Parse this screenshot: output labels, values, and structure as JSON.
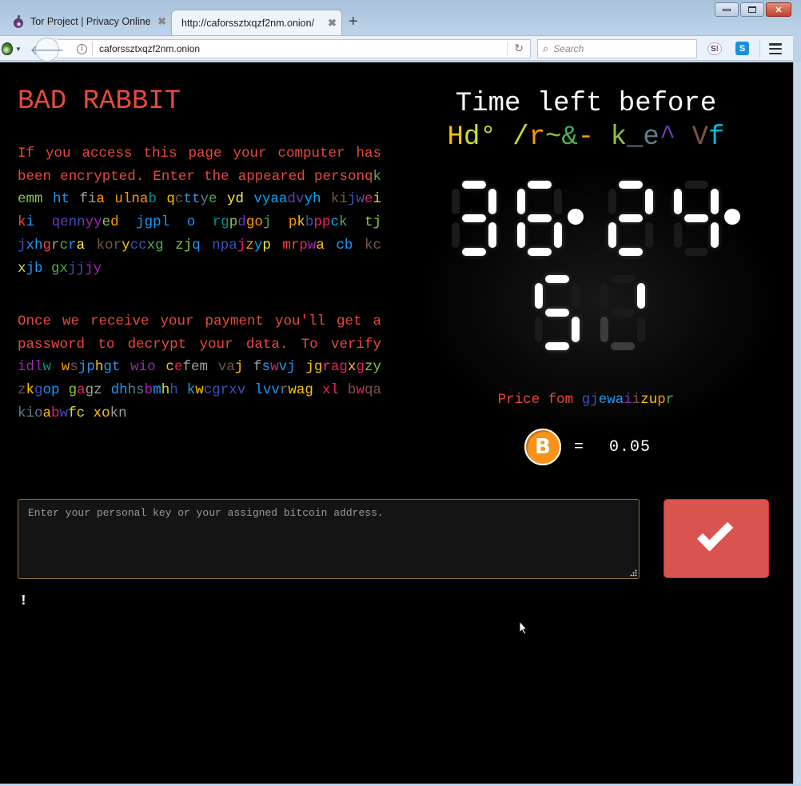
{
  "browser": {
    "tabs": [
      {
        "label": "Tor Project | Privacy Online",
        "icon": "tor-onion-icon",
        "active": false
      },
      {
        "label": "http://caforssztxqzf2nm.onion/",
        "active": true
      }
    ],
    "new_tab_label": "+",
    "close_tab_glyph": "✖",
    "url": "caforssztxqzf2nm.onion",
    "search_placeholder": "Search",
    "window_controls": {
      "minimize": "▭",
      "maximize": "▫",
      "close": "✕"
    },
    "extensions": [
      {
        "name": "S!",
        "color": "#1c3a8c"
      },
      {
        "name": "S",
        "color": "#1a8fdc"
      }
    ]
  },
  "page": {
    "title": "BAD RABBIT",
    "paragraph1": [
      [
        "If you access this page your computer has been encrypted. Enter the appeared person",
        "#e74a3b"
      ],
      [
        "q",
        "#e74a3b"
      ],
      [
        "k ",
        "#4caf50"
      ],
      [
        "emm ",
        "#8bc34a"
      ],
      [
        "ht ",
        "#2196f3"
      ],
      [
        "fi",
        "#9e9e9e"
      ],
      [
        "a ",
        "#ff9800"
      ],
      [
        "ulna",
        "#ff9800"
      ],
      [
        "b ",
        "#009688"
      ],
      [
        "q",
        "#ffc107"
      ],
      [
        "c",
        "#795548"
      ],
      [
        "tt",
        "#2196f3"
      ],
      [
        "y",
        "#607d8b"
      ],
      [
        "e ",
        "#4caf50"
      ],
      [
        "yd ",
        "#ffeb3b"
      ],
      [
        "vyaa",
        "#03a9f4"
      ],
      [
        "dv",
        "#673ab7"
      ],
      [
        "yh ",
        "#03a9f4"
      ],
      [
        "ki",
        "#795548"
      ],
      [
        "jw",
        "#3f51b5"
      ],
      [
        "e",
        "#e91e63"
      ],
      [
        "i ",
        "#cddc39"
      ],
      [
        "k",
        "#f44336"
      ],
      [
        "i ",
        "#2196f3"
      ],
      [
        "qe",
        "#673ab7"
      ],
      [
        "nn",
        "#3f51b5"
      ],
      [
        "yy",
        "#9c27b0"
      ],
      [
        "e",
        "#8bc34a"
      ],
      [
        "d ",
        "#ff9800"
      ],
      [
        "jgpl ",
        "#2196f3"
      ],
      [
        "o ",
        "#2196f3"
      ],
      [
        "rg",
        "#009688"
      ],
      [
        "p",
        "#8bc34a"
      ],
      [
        "d",
        "#673ab7"
      ],
      [
        "go",
        "#ff9800"
      ],
      [
        "j ",
        "#4caf50"
      ],
      [
        "p",
        "#ff9800"
      ],
      [
        "k",
        "#ffc107"
      ],
      [
        "b",
        "#3f51b5"
      ],
      [
        "pp",
        "#e91e63"
      ],
      [
        "c",
        "#03a9f4"
      ],
      [
        "k ",
        "#4caf50"
      ],
      [
        "tj ",
        "#8bc34a"
      ],
      [
        "j",
        "#3f51b5"
      ],
      [
        "xh",
        "#2196f3"
      ],
      [
        "g",
        "#f44336"
      ],
      [
        "r",
        "#9e9e9e"
      ],
      [
        "c",
        "#4caf50"
      ],
      [
        "r",
        "#2196f3"
      ],
      [
        "a ",
        "#ffeb3b"
      ],
      [
        "kor",
        "#795548"
      ],
      [
        "y",
        "#ffc107"
      ],
      [
        "cc",
        "#3f51b5"
      ],
      [
        "xg ",
        "#4caf50"
      ],
      [
        "zj",
        "#8bc34a"
      ],
      [
        "q ",
        "#2196f3"
      ],
      [
        "npa",
        "#3f51b5"
      ],
      [
        "j",
        "#e91e63"
      ],
      [
        "z",
        "#ff9800"
      ],
      [
        "y",
        "#03a9f4"
      ],
      [
        "p ",
        "#ffeb3b"
      ],
      [
        "mr",
        "#f44336"
      ],
      [
        "p",
        "#e91e63"
      ],
      [
        "w",
        "#9c27b0"
      ],
      [
        "a ",
        "#ffc107"
      ],
      [
        "cb ",
        "#2196f3"
      ],
      [
        "kc ",
        "#795548"
      ],
      [
        "x",
        "#cddc39"
      ],
      [
        "jb ",
        "#2196f3"
      ],
      [
        "gx",
        "#4caf50"
      ],
      [
        "jj",
        "#3f51b5"
      ],
      [
        "jy",
        "#9c27b0"
      ]
    ],
    "paragraph2": [
      [
        "Once we receive your payment you'll get a password to decrypt your data. To verify ",
        "#e74a3b"
      ],
      [
        "idl",
        "#9c27b0"
      ],
      [
        "w ",
        "#009688"
      ],
      [
        "w",
        "#ff9800"
      ],
      [
        "s",
        "#795548"
      ],
      [
        "jp",
        "#2196f3"
      ],
      [
        "h",
        "#ffc107"
      ],
      [
        "gt ",
        "#2196f3"
      ],
      [
        "wio ",
        "#9c27b0"
      ],
      [
        "c",
        "#ffc107"
      ],
      [
        "e",
        "#e91e63"
      ],
      [
        "fem ",
        "#9e9e9e"
      ],
      [
        "va",
        "#795548"
      ],
      [
        "j ",
        "#ffc107"
      ],
      [
        "f",
        "#9e9e9e"
      ],
      [
        "s",
        "#03a9f4"
      ],
      [
        "w",
        "#e91e63"
      ],
      [
        "v",
        "#03a9f4"
      ],
      [
        "j ",
        "#2196f3"
      ],
      [
        "jg",
        "#ffc107"
      ],
      [
        "r",
        "#f44336"
      ],
      [
        "ag",
        "#e91e63"
      ],
      [
        "x",
        "#ffc107"
      ],
      [
        "g",
        "#e91e63"
      ],
      [
        "zy ",
        "#8bc34a"
      ],
      [
        "z",
        "#795548"
      ],
      [
        "k",
        "#ffc107"
      ],
      [
        "g",
        "#3f51b5"
      ],
      [
        "op ",
        "#2196f3"
      ],
      [
        "g",
        "#8bc34a"
      ],
      [
        "a",
        "#e91e63"
      ],
      [
        "gz ",
        "#9e9e9e"
      ],
      [
        "dh",
        "#2196f3"
      ],
      [
        "hs",
        "#607d8b"
      ],
      [
        "b",
        "#9c27b0"
      ],
      [
        "m",
        "#2196f3"
      ],
      [
        "h",
        "#cddc39"
      ],
      [
        "h ",
        "#3f51b5"
      ],
      [
        "k",
        "#03a9f4"
      ],
      [
        "w",
        "#ffc107"
      ],
      [
        "c",
        "#3f51b5"
      ],
      [
        "grxv ",
        "#3f51b5"
      ],
      [
        "lvv",
        "#2196f3"
      ],
      [
        "r",
        "#607d8b"
      ],
      [
        "wag ",
        "#ffc107"
      ],
      [
        "xl ",
        "#e91e63"
      ],
      [
        "b",
        "#795548"
      ],
      [
        "w",
        "#e91e63"
      ],
      [
        "qa ",
        "#795548"
      ],
      [
        "kio",
        "#607d8b"
      ],
      [
        "a",
        "#ffc107"
      ],
      [
        "b",
        "#e91e63"
      ],
      [
        "w",
        "#3f51b5"
      ],
      [
        "fc ",
        "#cddc39"
      ],
      [
        "xo",
        "#ffc107"
      ],
      [
        "kn",
        "#9e9e9e"
      ]
    ],
    "timer": {
      "title": "Time left before",
      "subtitle": [
        [
          "H",
          "#ffc107"
        ],
        [
          "d° ",
          "#cddc39"
        ],
        [
          "/",
          "#cddc39"
        ],
        [
          "r",
          "#ff9800"
        ],
        [
          "~",
          "#8bc34a"
        ],
        [
          "&",
          "#4caf50"
        ],
        [
          "- ",
          "#ff9800"
        ],
        [
          "k",
          "#8bc34a"
        ],
        [
          "_",
          "#607d8b"
        ],
        [
          "e",
          "#607d8b"
        ],
        [
          "^ ",
          "#673ab7"
        ],
        [
          "V",
          "#795548"
        ],
        [
          "f",
          "#00bcd4"
        ]
      ],
      "display": "36:24:51",
      "hours": "36",
      "minutes": "24",
      "seconds": "51",
      "segments": {
        "3": [
          1,
          0,
          1,
          1,
          0,
          1,
          1
        ],
        "6": [
          1,
          1,
          0,
          1,
          1,
          1,
          1
        ],
        "2": [
          1,
          0,
          1,
          1,
          1,
          0,
          1
        ],
        "4": [
          0,
          1,
          1,
          1,
          0,
          1,
          0
        ],
        "5": [
          1,
          1,
          0,
          1,
          0,
          1,
          1
        ],
        "1t": [
          0,
          0,
          1,
          0,
          0.2,
          0,
          0.2
        ]
      },
      "digit_order": [
        "3",
        "6",
        "2",
        "4",
        "5",
        "1t"
      ]
    },
    "price": {
      "label": [
        [
          "Price fom ",
          "#e74a3b"
        ],
        [
          "gj",
          "#3f51b5"
        ],
        [
          "ewa",
          "#2196f3"
        ],
        [
          "i",
          "#9c27b0"
        ],
        [
          "i",
          "#795548"
        ],
        [
          "zu",
          "#ffc107"
        ],
        [
          "p",
          "#ff9800"
        ],
        [
          "r",
          "#4caf50"
        ]
      ],
      "currency_icon": "bitcoin-icon",
      "currency_glyph": "B",
      "equals": "=",
      "amount": "0.05"
    },
    "key_input": {
      "placeholder": "Enter your personal key or your assigned bitcoin address.",
      "value": ""
    },
    "submit_glyph": "check-icon",
    "status_text": "!"
  },
  "colors": {
    "accent_red": "#e74a3b",
    "button_red": "#d9534f",
    "input_border": "#8a6d3b",
    "background": "#000000"
  }
}
